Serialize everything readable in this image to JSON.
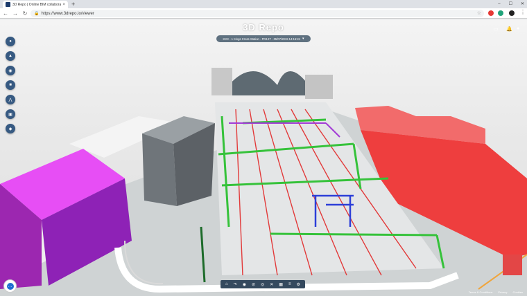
{
  "browser": {
    "tab_title": "3D Repo | Online BIM collaboration",
    "tab_close": "×",
    "new_tab": "+",
    "window_controls": [
      "–",
      "☐",
      "✕"
    ],
    "back": "←",
    "forward": "→",
    "reload": "↻",
    "url": "https://www.3drepo.io/viewer"
  },
  "viewer": {
    "brand": "3D Repo",
    "revision": "KXX - 1 Kings Cross Station - P03.27 - 05/07/2019 14:15:24",
    "left_panel_icons": [
      "map-marker-icon",
      "warning-icon",
      "gis-icon",
      "view-icon",
      "tree-icon",
      "clip-icon",
      "compare-icon"
    ],
    "toolbar_icons": [
      "home-icon",
      "turntable-icon",
      "eye-icon",
      "hide-icon",
      "show-icon",
      "isolate-icon",
      "clip-icon",
      "metadata-icon",
      "settings-icon"
    ],
    "footer_links": [
      "Terms & Conditions",
      "Privacy",
      "Cookies"
    ]
  },
  "colors": {
    "brand_blue": "#375a82",
    "toolbar": "#34495e",
    "magenta_building": "#c93ad6",
    "red_building": "#f04c4c"
  }
}
